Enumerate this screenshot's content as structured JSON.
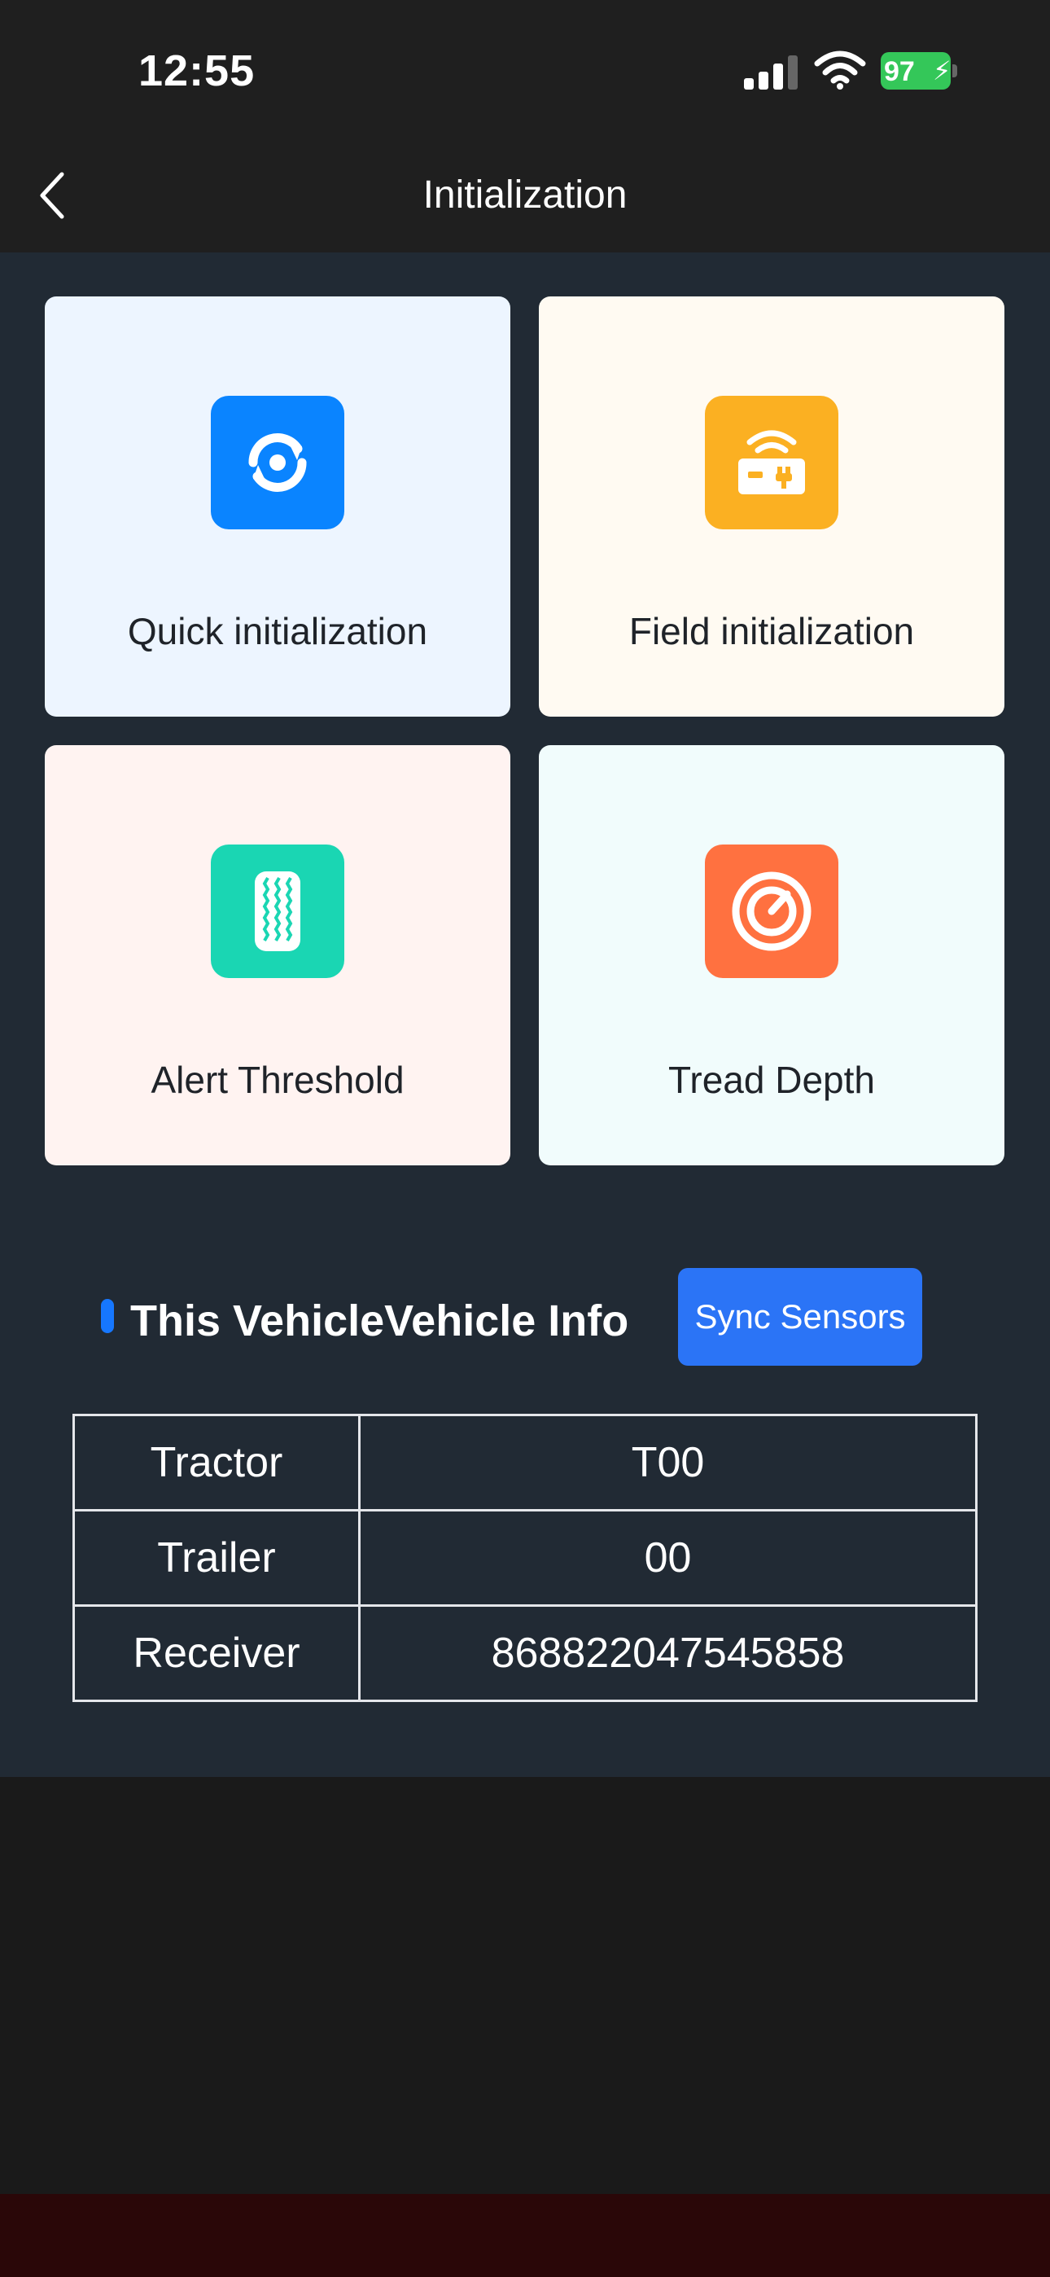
{
  "status_bar": {
    "time": "12:55",
    "battery": "97"
  },
  "nav": {
    "title": "Initialization"
  },
  "cards": [
    {
      "label": "Quick initialization",
      "icon": "sync-icon",
      "color": "#0a84ff"
    },
    {
      "label": "Field initialization",
      "icon": "wireless-device-icon",
      "color": "#fbb022"
    },
    {
      "label": "Alert Threshold",
      "icon": "tire-tread-icon",
      "color": "#1ad6b3"
    },
    {
      "label": "Tread Depth",
      "icon": "gauge-icon",
      "color": "#ff7140"
    }
  ],
  "vehicle_section": {
    "title": "This VehicleVehicle Info",
    "sync_label": "Sync Sensors",
    "rows": [
      {
        "key": "Tractor",
        "value": "T00"
      },
      {
        "key": "Trailer",
        "value": "00"
      },
      {
        "key": "Receiver",
        "value": "868822047545858"
      }
    ]
  },
  "colors": {
    "accent": "#2b74f6",
    "content_bg": "#212a34",
    "header_bg": "#1f1f1f",
    "battery": "#34c759"
  }
}
